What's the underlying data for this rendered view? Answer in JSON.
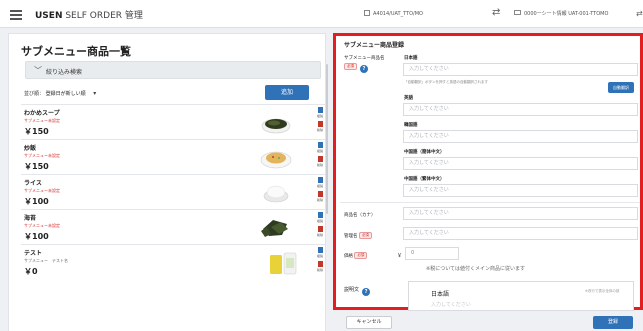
{
  "header": {
    "brand_bold": "USEN",
    "brand_rest": " SELF ORDER 管理",
    "store": "A4014/UAT_TTO/MO",
    "seat": "0000ーシート情報 UAT-001-TTOMO"
  },
  "list_panel": {
    "title": "サブメニュー商品一覧",
    "filter_label": "絞り込み検索",
    "sort_prefix": "並び順：",
    "sort_value": "登録日が新しい順",
    "add_label": "追加",
    "copy_label": "複製",
    "delete_label": "削除",
    "items": [
      {
        "name": "わかめスープ",
        "sub": "サブメニュー未設定",
        "price": "￥150"
      },
      {
        "name": "炒飯",
        "sub": "サブメニュー未設定",
        "price": "￥150"
      },
      {
        "name": "ライス",
        "sub": "サブメニュー未設定",
        "price": "￥100"
      },
      {
        "name": "海苔",
        "sub": "サブメニュー未設定",
        "price": "￥100"
      },
      {
        "name": "テスト",
        "sub": "サブメニュー　テスト名",
        "price": "￥0"
      }
    ]
  },
  "form": {
    "title": "サブメニュー商品登録",
    "name_label": "サブメニュー商品名",
    "required_badge": "必須",
    "lang_ja": "日本語",
    "lang_en": "英語",
    "lang_ko": "韓国語",
    "lang_zh_s": "中国語（簡体中文）",
    "lang_zh_t": "中国語（繁体中文）",
    "placeholder": "入力してください",
    "translate_note": "「自動翻訳」ボタンを押すと英語の自動翻訳されます",
    "auto_translate": "自動翻訳",
    "kana_label": "商品名（カナ）",
    "admin_label": "管理名",
    "price_label": "価格",
    "price_prefix": "￥",
    "price_value": "0",
    "price_note": "※税については値付くメイン商品に従います",
    "desc_label": "説明文",
    "desc_lang": "日本語",
    "desc_note": "※改行で表示全体の部",
    "desc_placeholder": "入力してください"
  },
  "footer": {
    "cancel": "キャンセル",
    "save": "登録"
  }
}
